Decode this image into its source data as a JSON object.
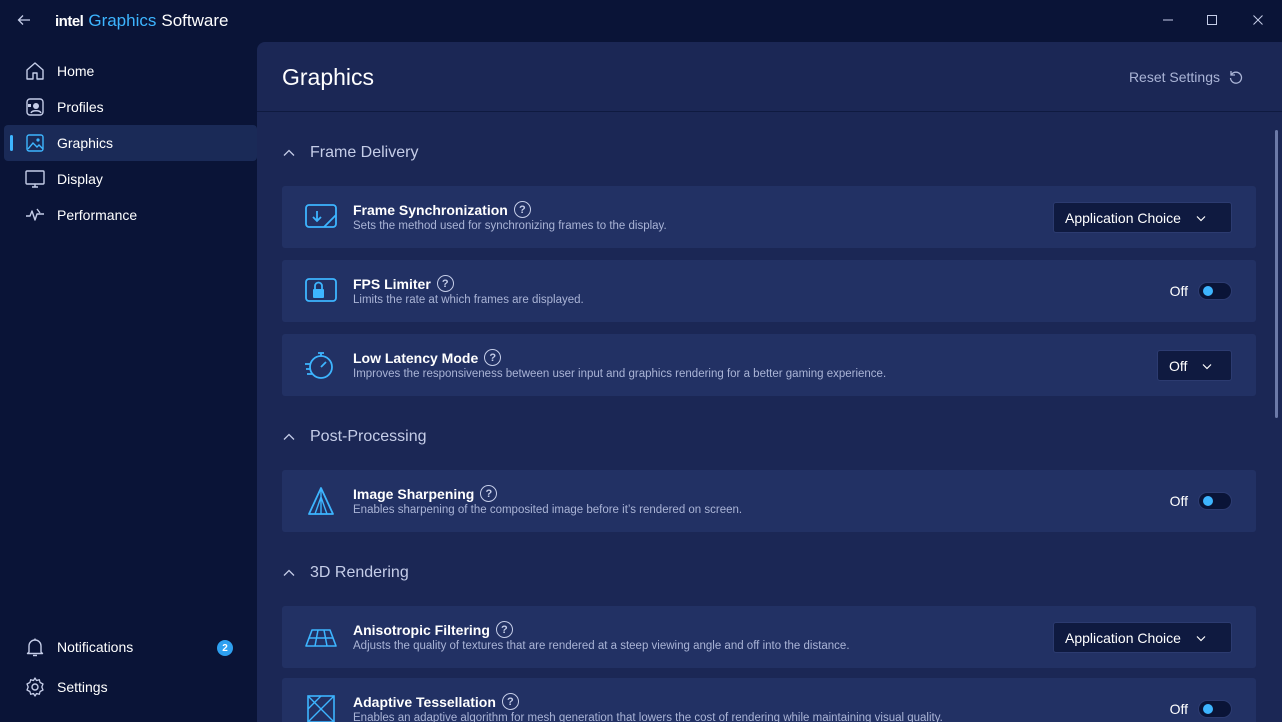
{
  "titlebar": {
    "brand": "intel",
    "product": "Graphics",
    "suffix": "Software"
  },
  "sidebar": {
    "items": [
      {
        "label": "Home",
        "icon": "home-icon"
      },
      {
        "label": "Profiles",
        "icon": "profiles-icon"
      },
      {
        "label": "Graphics",
        "icon": "graphics-icon",
        "active": true
      },
      {
        "label": "Display",
        "icon": "display-icon"
      },
      {
        "label": "Performance",
        "icon": "performance-icon"
      }
    ],
    "bottom": [
      {
        "label": "Notifications",
        "icon": "bell-icon",
        "badge": "2"
      },
      {
        "label": "Settings",
        "icon": "gear-icon"
      }
    ]
  },
  "main": {
    "title": "Graphics",
    "reset_label": "Reset Settings",
    "sections": [
      {
        "title": "Frame Delivery"
      },
      {
        "title": "Post-Processing"
      },
      {
        "title": "3D Rendering"
      }
    ],
    "rows": [
      {
        "title": "Frame Synchronization",
        "desc": "Sets the method used for synchronizing frames to the display.",
        "control": "dropdown",
        "value": "Application Choice"
      },
      {
        "title": "FPS Limiter",
        "desc": "Limits the rate at which frames are displayed.",
        "control": "toggle",
        "value": "Off"
      },
      {
        "title": "Low Latency Mode",
        "desc": "Improves the responsiveness between user input and graphics rendering for a better gaming experience.",
        "control": "dropdown",
        "value": "Off"
      },
      {
        "title": "Image Sharpening",
        "desc": "Enables sharpening of the composited image before it’s rendered on screen.",
        "control": "toggle",
        "value": "Off"
      },
      {
        "title": "Anisotropic Filtering",
        "desc": "Adjusts the quality of textures that are rendered at a steep viewing angle and off into the distance.",
        "control": "dropdown",
        "value": "Application Choice"
      },
      {
        "title": "Adaptive Tessellation",
        "desc": "Enables an adaptive algorithm for mesh generation that lowers the cost of rendering while maintaining visual quality.",
        "control": "toggle",
        "value": "Off"
      }
    ],
    "help_glyph": "?"
  },
  "colors": {
    "background": "#0a1437",
    "panel": "#1b2755",
    "row": "#223164",
    "accent": "#3db5ff"
  }
}
